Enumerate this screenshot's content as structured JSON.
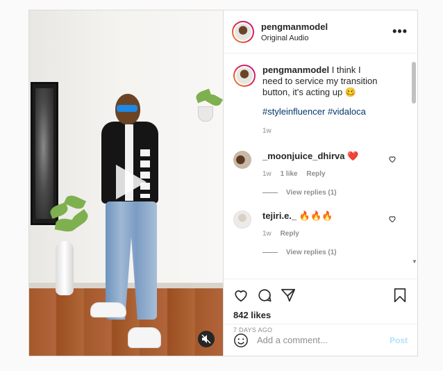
{
  "header": {
    "username": "pengmanmodel",
    "audio": "Original Audio",
    "more_icon": "more-horizontal-icon"
  },
  "caption": {
    "username": "pengmanmodel",
    "text": "I think I need to service my transition button, it's acting up 🥴",
    "hashtags": "#styleinfluencer #vidaloca",
    "time": "1w"
  },
  "comments": [
    {
      "username": "_moonjuice_dhirva",
      "text": "❤️",
      "time": "1w",
      "likes": "1 like",
      "reply": "Reply",
      "view_replies": "View replies (1)"
    },
    {
      "username": "tejiri.e._",
      "text": "🔥🔥🔥",
      "time": "1w",
      "reply": "Reply",
      "view_replies": "View replies (1)"
    }
  ],
  "actions": {
    "likes": "842 likes",
    "date": "7 DAYS AGO"
  },
  "add_comment": {
    "placeholder": "Add a comment...",
    "post_label": "Post"
  },
  "colors": {
    "link": "#00376b",
    "muted": "#8e8e8e",
    "post_disabled": "#b2dffc",
    "story_ring_start": "#f09433",
    "story_ring_end": "#bc1888"
  }
}
